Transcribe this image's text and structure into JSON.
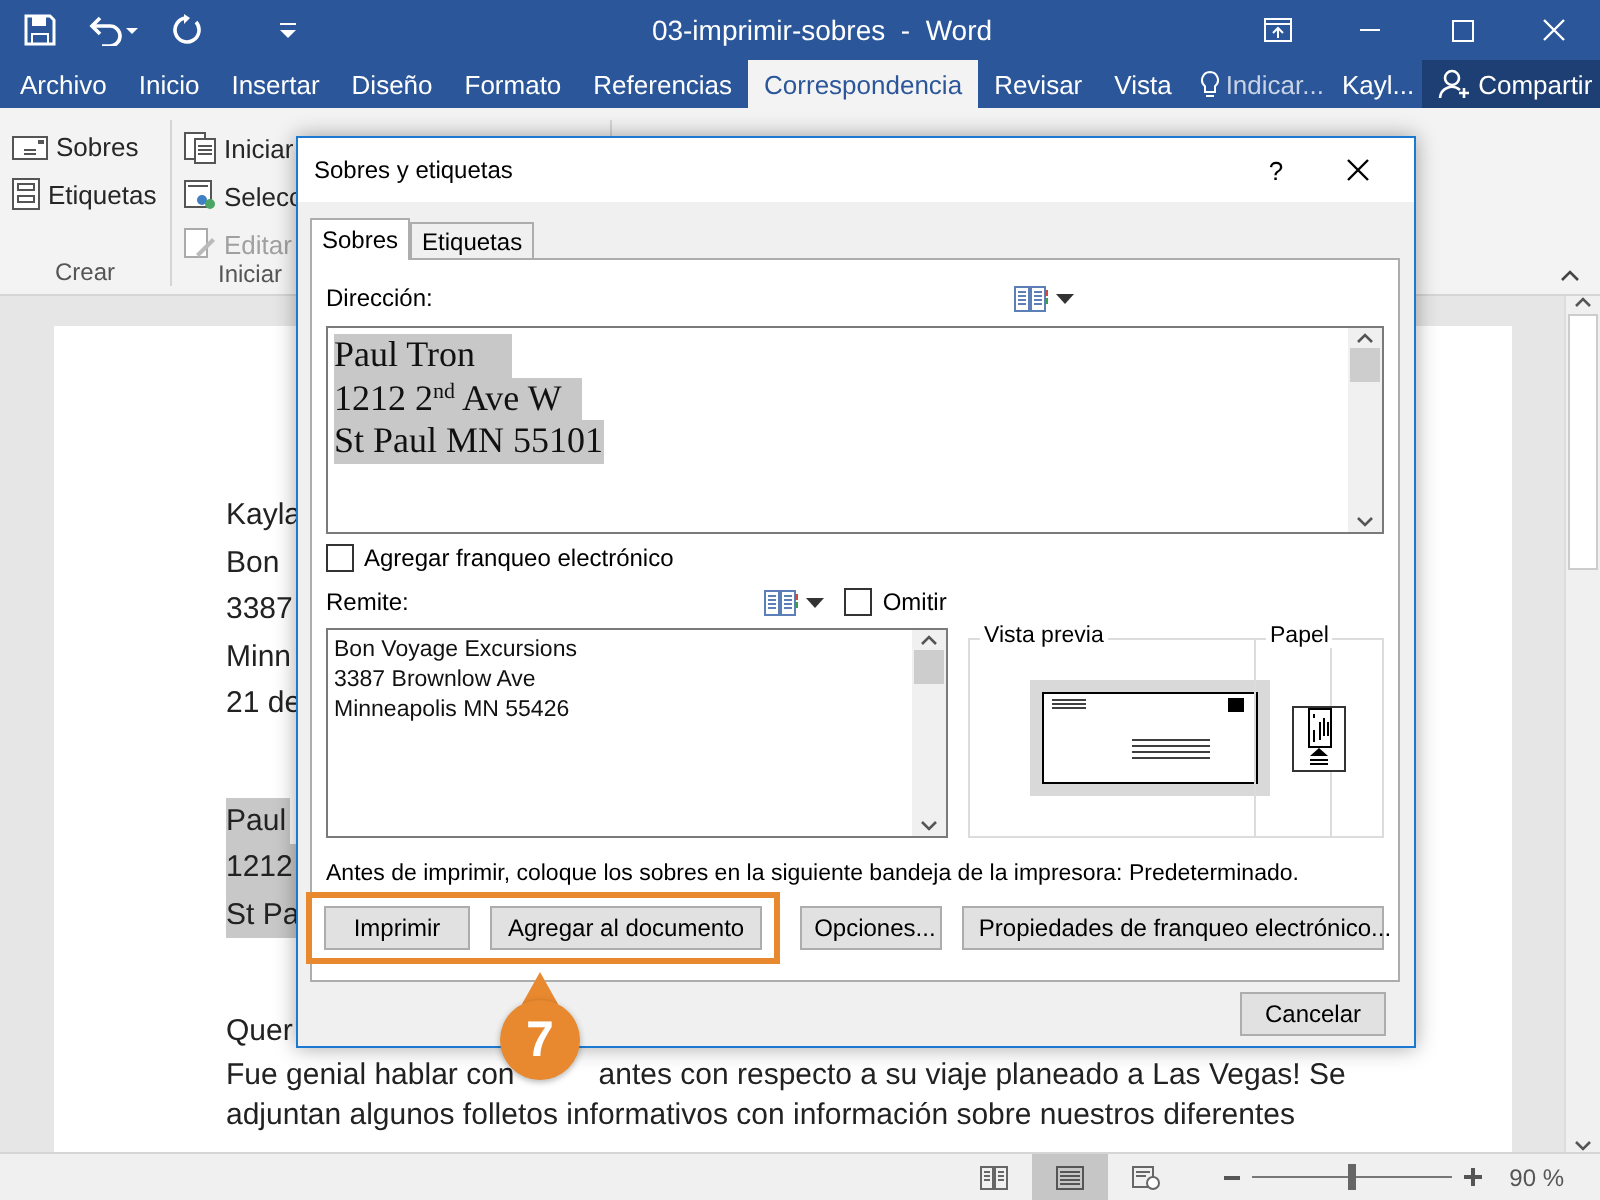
{
  "title_bar": {
    "title": "03-imprimir-sobres  -  Word"
  },
  "ribbon_tabs": [
    {
      "label": "Archivo",
      "selected": false
    },
    {
      "label": "Inicio",
      "selected": false
    },
    {
      "label": "Insertar",
      "selected": false
    },
    {
      "label": "Diseño",
      "selected": false
    },
    {
      "label": "Formato",
      "selected": false
    },
    {
      "label": "Referencias",
      "selected": false
    },
    {
      "label": "Correspondencia",
      "selected": true
    },
    {
      "label": "Revisar",
      "selected": false
    },
    {
      "label": "Vista",
      "selected": false
    }
  ],
  "tell_me": "Indicar...",
  "user": "Kayl...",
  "share": "Compartir",
  "ribbon": {
    "groups": [
      {
        "label": "Crear",
        "items": [
          {
            "label": "Sobres",
            "kind": "envelope",
            "disabled": false
          },
          {
            "label": "Etiquetas",
            "kind": "labels",
            "disabled": false
          }
        ]
      },
      {
        "label": "Iniciar",
        "items": [
          {
            "label": "Iniciar",
            "kind": "merge",
            "disabled": false
          },
          {
            "label": "Selecc",
            "kind": "recipients",
            "disabled": false
          },
          {
            "label": "Editar",
            "kind": "edit",
            "disabled": true
          }
        ]
      }
    ]
  },
  "document": {
    "blocks": [
      {
        "highlighted": false,
        "lines": [
          "Kayla",
          "Bon",
          "3387",
          "Minn",
          "21 de"
        ]
      },
      {
        "highlighted": true,
        "lines": [
          "Paul",
          "1212",
          "St Pa"
        ]
      },
      {
        "highlighted": false,
        "lines": [
          "Quer",
          [
            "Fue genial hablar con",
            "antes con respecto a su viaje planeado a Las Vegas! Se"
          ],
          "adjuntan algunos folletos informativos con información sobre nuestros diferentes"
        ]
      }
    ]
  },
  "dialog": {
    "title": "Sobres y etiquetas",
    "help": "?",
    "tabs": [
      {
        "label": "Sobres",
        "selected": true
      },
      {
        "label": "Etiquetas",
        "selected": false
      }
    ],
    "address_label": "Dirección:",
    "address": {
      "highlighted": true,
      "lines": [
        "Paul Tron",
        "1212 2$^{nd}$ Ave W",
        "St Paul MN 55101"
      ]
    },
    "epostage": {
      "label": "Agregar franqueo electrónico",
      "checked": false
    },
    "return_label": "Remite:",
    "omit": {
      "label": "Omitir",
      "checked": false
    },
    "return_address": [
      "Bon Voyage Excursions",
      "3387 Brownlow Ave",
      "Minneapolis MN 55426"
    ],
    "preview_label": "Vista previa",
    "paper_label": "Papel",
    "note": "Antes de imprimir, coloque los sobres en la siguiente bandeja de la impresora: Predeterminado.",
    "buttons": [
      {
        "label": "Imprimir",
        "highlighted": true
      },
      {
        "label": "Agregar al documento",
        "highlighted": true
      },
      {
        "label": "Opciones...",
        "highlighted": false
      },
      {
        "label": "Propiedades de franqueo electrónico...",
        "highlighted": false
      }
    ],
    "cancel": "Cancelar"
  },
  "callout": {
    "number": "7"
  },
  "status_bar": {
    "views": [
      {
        "selected": false
      },
      {
        "selected": true
      },
      {
        "selected": false
      }
    ],
    "zoom": {
      "level": 0.5
    },
    "zoom_text": "90 %"
  }
}
